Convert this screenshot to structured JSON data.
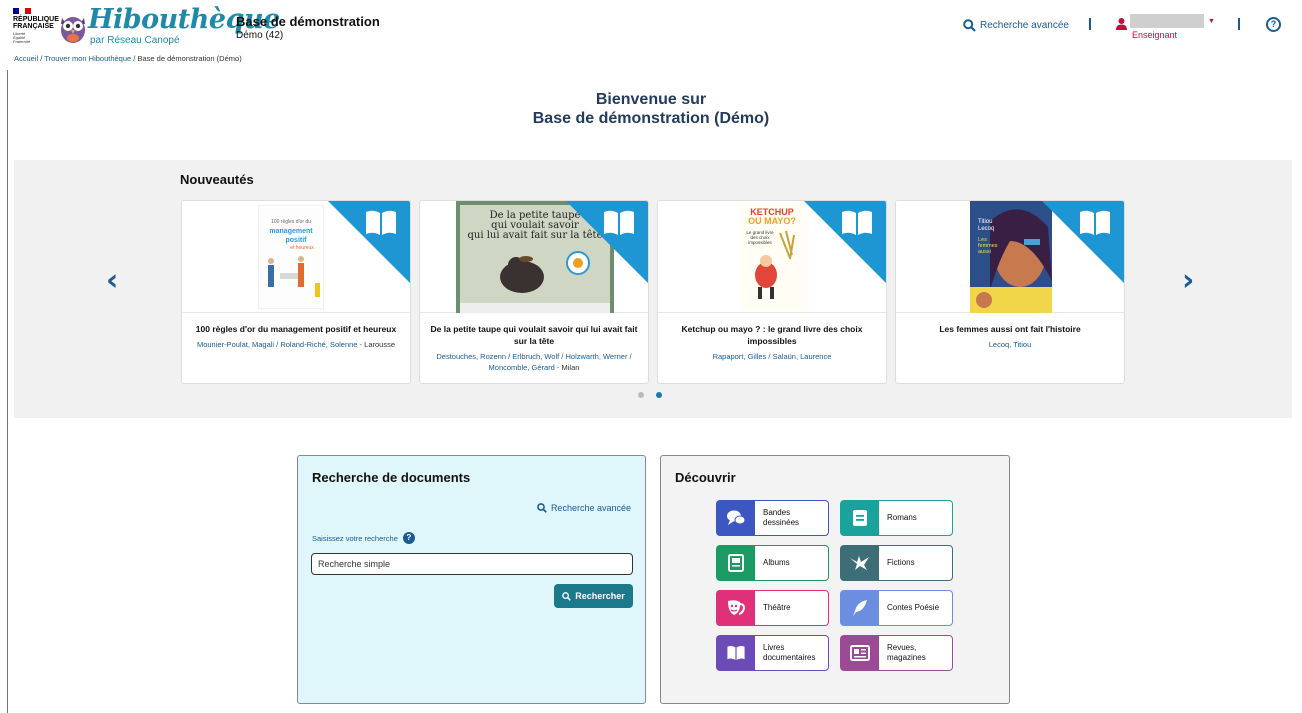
{
  "header": {
    "rf_lines": [
      "RÉPUBLIQUE",
      "FRANÇAISE"
    ],
    "rf_motto": [
      "Liberté",
      "Égalité",
      "Fraternité"
    ],
    "brand": "Hibouthèque",
    "brand_sub": "par Réseau Canopé",
    "base_title": "Base de démonstration",
    "base_sub": "Démo (42)",
    "advanced_search": "Recherche avancée",
    "user_role": "Enseignant",
    "help_glyph": "?"
  },
  "breadcrumb": {
    "items": [
      "Accueil",
      "Trouver mon Hibouthèque",
      "Base de démonstration (Démo)"
    ],
    "separator": "/"
  },
  "welcome": {
    "line1": "Bienvenue sur",
    "line2": "Base de démonstration (Démo)"
  },
  "carousel": {
    "title": "Nouveautés",
    "prev": "‹",
    "next": "›",
    "cards": [
      {
        "title": "100 règles d'or du management positif et heureux",
        "authors": "Mounier-Poulat, Magali / Roland-Riché, Solenne",
        "publisher": "Larousse",
        "cover_text": "100 règles d'or du management positif et heureux"
      },
      {
        "title": "De la petite taupe qui voulait savoir qui lui avait fait sur la tête",
        "authors": "Destouches, Rozenn / Erlbruch, Wolf / Holzwarth, Werner / Moncomble, Gérard",
        "publisher": "Milan",
        "cover_text": "De la petite taupe qui voulait savoir qui lui avait fait sur la tête"
      },
      {
        "title": "Ketchup ou mayo ? : le grand livre des choix impossibles",
        "authors": "Rapaport, Gilles / Salaün, Laurence",
        "publisher": "",
        "cover_text": "KETCHUP OU MAYO?"
      },
      {
        "title": "Les femmes aussi ont fait l'histoire",
        "authors": "Lecoq, Titiou",
        "publisher": "",
        "cover_text": "Titiou Lecoq"
      }
    ],
    "active_page": 2,
    "page_count": 2
  },
  "search": {
    "title": "Recherche de documents",
    "advanced": "Recherche avancée",
    "label": "Saisissez votre recherche",
    "placeholder": "Recherche simple",
    "button": "Rechercher"
  },
  "discover": {
    "title": "Découvrir",
    "categories": [
      {
        "label": "Bandes dessinées",
        "color": "#3d57c2",
        "icon": "speech-bubbles-icon"
      },
      {
        "label": "Romans",
        "color": "#1aa39c",
        "icon": "book-lines-icon"
      },
      {
        "label": "Albums",
        "color": "#1c9a63",
        "icon": "picture-book-icon"
      },
      {
        "label": "Fictions",
        "color": "#3d6e78",
        "icon": "dragon-icon"
      },
      {
        "label": "Théâtre",
        "color": "#e0307a",
        "icon": "theatre-masks-icon"
      },
      {
        "label": "Contes Poésie",
        "color": "#6b8ee0",
        "icon": "quill-icon"
      },
      {
        "label": "Livres documentaires",
        "color": "#6c4bb8",
        "icon": "open-book-icon"
      },
      {
        "label": "Revues, magazines",
        "color": "#9b4a95",
        "icon": "newspaper-icon"
      }
    ]
  },
  "colors": {
    "brand": "#1f8aa8",
    "link": "#1a5c94",
    "heading": "#233b5d",
    "ribbon": "#1e96d3",
    "search_button": "#1a7a8c",
    "search_panel_bg": "#dff6fb",
    "user_role": "#c40f3d"
  }
}
